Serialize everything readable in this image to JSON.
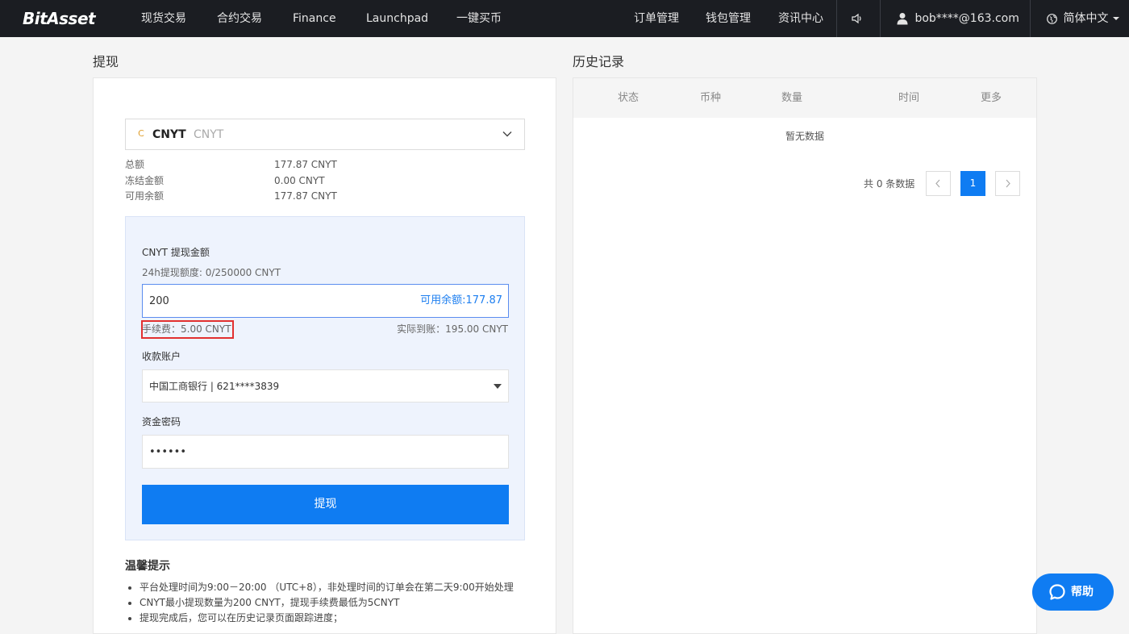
{
  "nav": {
    "logo": "BitAsset",
    "items": [
      "现货交易",
      "合约交易",
      "Finance",
      "Launchpad",
      "一键买币"
    ],
    "right_items": [
      "订单管理",
      "钱包管理",
      "资讯中心"
    ],
    "user": "bob****@163.com",
    "language": "简体中文"
  },
  "withdraw": {
    "title": "提现",
    "coin": {
      "logo_letter": "C",
      "symbol": "CNYT",
      "name": "CNYT"
    },
    "balances": [
      {
        "label": "总额",
        "value": "177.87 CNYT"
      },
      {
        "label": "冻结金额",
        "value": "0.00 CNYT"
      },
      {
        "label": "可用余额",
        "value": "177.87 CNYT"
      }
    ],
    "form": {
      "amount_label": "CNYT 提现金额",
      "limit_text": "24h提现额度: 0/250000 CNYT",
      "amount_value": "200",
      "available_text": "可用余额:177.87",
      "fee_text": "手续费：5.00 CNYT",
      "actual_text": "实际到账：195.00 CNYT",
      "account_label": "收款账户",
      "account_value": "中国工商银行 | 621****3839",
      "password_label": "资金密码",
      "password_value": "••••••",
      "submit_label": "提现"
    },
    "tips": {
      "title": "温馨提示",
      "items": [
        "平台处理时间为9:00－20:00 （UTC+8），非处理时间的订单会在第二天9:00开始处理",
        "CNYT最小提现数量为200 CNYT，提现手续费最低为5CNYT",
        "提现完成后，您可以在历史记录页面跟踪进度；"
      ]
    }
  },
  "history": {
    "title": "历史记录",
    "columns": [
      "状态",
      "币种",
      "数量",
      "时间",
      "更多"
    ],
    "empty_text": "暂无数据",
    "total_text": "共 0 条数据",
    "current_page": "1"
  },
  "help": {
    "label": "帮助"
  },
  "colors": {
    "accent": "#0f7cf2",
    "highlight_border": "#e23030",
    "nav_bg": "#1b1d22"
  }
}
